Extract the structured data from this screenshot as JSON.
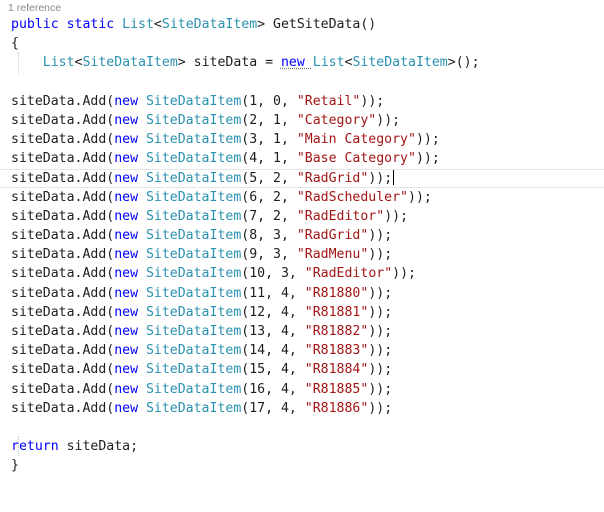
{
  "codelens": "1 reference",
  "lines": [
    [
      {
        "t": "kw",
        "v": "public static "
      },
      {
        "t": "ty",
        "v": "List"
      },
      {
        "t": "pl",
        "v": "<"
      },
      {
        "t": "ty",
        "v": "SiteDataItem"
      },
      {
        "t": "pl",
        "v": "> GetSiteData()"
      }
    ],
    [
      {
        "t": "pl",
        "v": "{"
      }
    ],
    [
      {
        "t": "pl",
        "v": "    "
      },
      {
        "t": "ty",
        "v": "List"
      },
      {
        "t": "pl",
        "v": "<"
      },
      {
        "t": "ty",
        "v": "SiteDataItem"
      },
      {
        "t": "pl",
        "v": "> siteData = "
      },
      {
        "t": "kw",
        "v": "new "
      },
      {
        "t": "ty",
        "v": "List"
      },
      {
        "t": "pl",
        "v": "<"
      },
      {
        "t": "ty",
        "v": "SiteDataItem"
      },
      {
        "t": "pl",
        "v": ">();"
      }
    ],
    [],
    [
      {
        "t": "pl",
        "v": "siteData.Add("
      },
      {
        "t": "kw",
        "v": "new "
      },
      {
        "t": "ty",
        "v": "SiteDataItem"
      },
      {
        "t": "pl",
        "v": "(1, 0, "
      },
      {
        "t": "str",
        "v": "\"Retail\""
      },
      {
        "t": "pl",
        "v": "));"
      }
    ],
    [
      {
        "t": "pl",
        "v": "siteData.Add("
      },
      {
        "t": "kw",
        "v": "new "
      },
      {
        "t": "ty",
        "v": "SiteDataItem"
      },
      {
        "t": "pl",
        "v": "(2, 1, "
      },
      {
        "t": "str",
        "v": "\"Category\""
      },
      {
        "t": "pl",
        "v": "));"
      }
    ],
    [
      {
        "t": "pl",
        "v": "siteData.Add("
      },
      {
        "t": "kw",
        "v": "new "
      },
      {
        "t": "ty",
        "v": "SiteDataItem"
      },
      {
        "t": "pl",
        "v": "(3, 1, "
      },
      {
        "t": "str",
        "v": "\"Main Category\""
      },
      {
        "t": "pl",
        "v": "));"
      }
    ],
    [
      {
        "t": "pl",
        "v": "siteData.Add("
      },
      {
        "t": "kw",
        "v": "new "
      },
      {
        "t": "ty",
        "v": "SiteDataItem"
      },
      {
        "t": "pl",
        "v": "(4, 1, "
      },
      {
        "t": "str",
        "v": "\"Base Category\""
      },
      {
        "t": "pl",
        "v": "));"
      }
    ],
    [
      {
        "t": "pl",
        "v": "siteData.Add("
      },
      {
        "t": "kw",
        "v": "new "
      },
      {
        "t": "ty",
        "v": "SiteDataItem"
      },
      {
        "t": "pl",
        "v": "(5, 2, "
      },
      {
        "t": "str",
        "v": "\"RadGrid\""
      },
      {
        "t": "pl",
        "v": "));"
      }
    ],
    [
      {
        "t": "pl",
        "v": "siteData.Add("
      },
      {
        "t": "kw",
        "v": "new "
      },
      {
        "t": "ty",
        "v": "SiteDataItem"
      },
      {
        "t": "pl",
        "v": "(6, 2, "
      },
      {
        "t": "str",
        "v": "\"RadScheduler\""
      },
      {
        "t": "pl",
        "v": "));"
      }
    ],
    [
      {
        "t": "pl",
        "v": "siteData.Add("
      },
      {
        "t": "kw",
        "v": "new "
      },
      {
        "t": "ty",
        "v": "SiteDataItem"
      },
      {
        "t": "pl",
        "v": "(7, 2, "
      },
      {
        "t": "str",
        "v": "\"RadEditor\""
      },
      {
        "t": "pl",
        "v": "));"
      }
    ],
    [
      {
        "t": "pl",
        "v": "siteData.Add("
      },
      {
        "t": "kw",
        "v": "new "
      },
      {
        "t": "ty",
        "v": "SiteDataItem"
      },
      {
        "t": "pl",
        "v": "(8, 3, "
      },
      {
        "t": "str",
        "v": "\"RadGrid\""
      },
      {
        "t": "pl",
        "v": "));"
      }
    ],
    [
      {
        "t": "pl",
        "v": "siteData.Add("
      },
      {
        "t": "kw",
        "v": "new "
      },
      {
        "t": "ty",
        "v": "SiteDataItem"
      },
      {
        "t": "pl",
        "v": "(9, 3, "
      },
      {
        "t": "str",
        "v": "\"RadMenu\""
      },
      {
        "t": "pl",
        "v": "));"
      }
    ],
    [
      {
        "t": "pl",
        "v": "siteData.Add("
      },
      {
        "t": "kw",
        "v": "new "
      },
      {
        "t": "ty",
        "v": "SiteDataItem"
      },
      {
        "t": "pl",
        "v": "(10, 3, "
      },
      {
        "t": "str",
        "v": "\"RadEditor\""
      },
      {
        "t": "pl",
        "v": "));"
      }
    ],
    [
      {
        "t": "pl",
        "v": "siteData.Add("
      },
      {
        "t": "kw",
        "v": "new "
      },
      {
        "t": "ty",
        "v": "SiteDataItem"
      },
      {
        "t": "pl",
        "v": "(11, 4, "
      },
      {
        "t": "str",
        "v": "\"R81880\""
      },
      {
        "t": "pl",
        "v": "));"
      }
    ],
    [
      {
        "t": "pl",
        "v": "siteData.Add("
      },
      {
        "t": "kw",
        "v": "new "
      },
      {
        "t": "ty",
        "v": "SiteDataItem"
      },
      {
        "t": "pl",
        "v": "(12, 4, "
      },
      {
        "t": "str",
        "v": "\"R81881\""
      },
      {
        "t": "pl",
        "v": "));"
      }
    ],
    [
      {
        "t": "pl",
        "v": "siteData.Add("
      },
      {
        "t": "kw",
        "v": "new "
      },
      {
        "t": "ty",
        "v": "SiteDataItem"
      },
      {
        "t": "pl",
        "v": "(13, 4, "
      },
      {
        "t": "str",
        "v": "\"R81882\""
      },
      {
        "t": "pl",
        "v": "));"
      }
    ],
    [
      {
        "t": "pl",
        "v": "siteData.Add("
      },
      {
        "t": "kw",
        "v": "new "
      },
      {
        "t": "ty",
        "v": "SiteDataItem"
      },
      {
        "t": "pl",
        "v": "(14, 4, "
      },
      {
        "t": "str",
        "v": "\"R81883\""
      },
      {
        "t": "pl",
        "v": "));"
      }
    ],
    [
      {
        "t": "pl",
        "v": "siteData.Add("
      },
      {
        "t": "kw",
        "v": "new "
      },
      {
        "t": "ty",
        "v": "SiteDataItem"
      },
      {
        "t": "pl",
        "v": "(15, 4, "
      },
      {
        "t": "str",
        "v": "\"R81884\""
      },
      {
        "t": "pl",
        "v": "));"
      }
    ],
    [
      {
        "t": "pl",
        "v": "siteData.Add("
      },
      {
        "t": "kw",
        "v": "new "
      },
      {
        "t": "ty",
        "v": "SiteDataItem"
      },
      {
        "t": "pl",
        "v": "(16, 4, "
      },
      {
        "t": "str",
        "v": "\"R81885\""
      },
      {
        "t": "pl",
        "v": "));"
      }
    ],
    [
      {
        "t": "pl",
        "v": "siteData.Add("
      },
      {
        "t": "kw",
        "v": "new "
      },
      {
        "t": "ty",
        "v": "SiteDataItem"
      },
      {
        "t": "pl",
        "v": "(17, 4, "
      },
      {
        "t": "str",
        "v": "\"R81886\""
      },
      {
        "t": "pl",
        "v": "));"
      }
    ],
    [],
    [
      {
        "t": "kw",
        "v": "return "
      },
      {
        "t": "pl",
        "v": "siteData;"
      }
    ],
    [
      {
        "t": "pl",
        "v": "}"
      }
    ]
  ],
  "current_line": 8,
  "colors": {
    "keyword": "#0000ff",
    "type": "#2b91af",
    "string": "#a31515",
    "plain": "#1e1e1e"
  }
}
